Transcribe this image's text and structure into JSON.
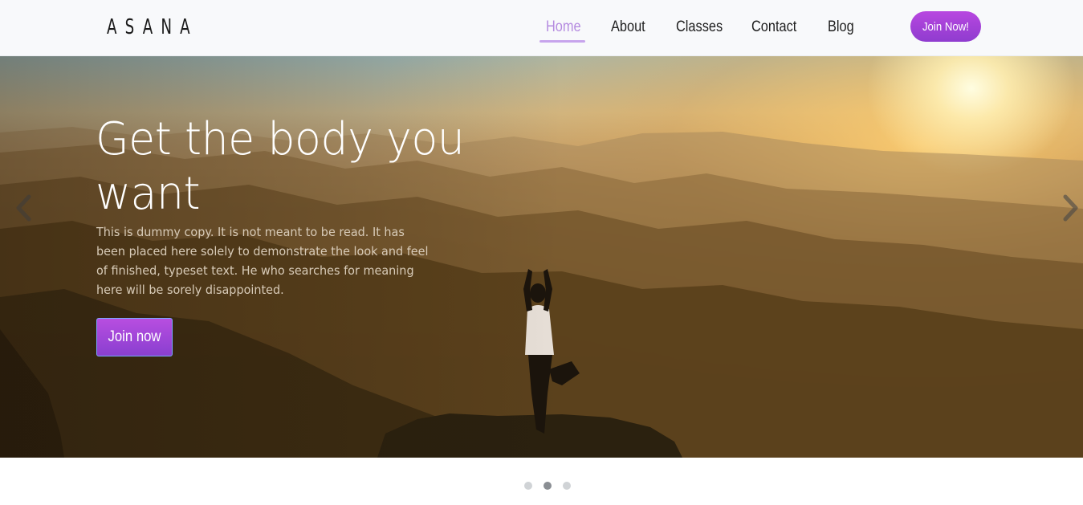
{
  "brand": {
    "logo_text": "ASANA"
  },
  "nav": {
    "items": [
      {
        "label": "Home",
        "active": true
      },
      {
        "label": "About",
        "active": false
      },
      {
        "label": "Classes",
        "active": false
      },
      {
        "label": "Contact",
        "active": false
      },
      {
        "label": "Blog",
        "active": false
      }
    ],
    "cta_label": "Join Now!"
  },
  "hero": {
    "title": "Get the body you want",
    "body": "This is dummy copy. It is not meant to be read. It has been placed here solely to demonstrate the look and feel of finished, typeset text. He who searches for meaning here will be sorely disappointed.",
    "button_label": "Join now",
    "prev_icon": "chevron-left-icon",
    "next_icon": "chevron-right-icon"
  },
  "carousel": {
    "slide_count": 3,
    "active_index": 1
  },
  "colors": {
    "accent": "#b847e0",
    "nav_active": "#b58be0",
    "header_bg": "#f8f9fb"
  }
}
